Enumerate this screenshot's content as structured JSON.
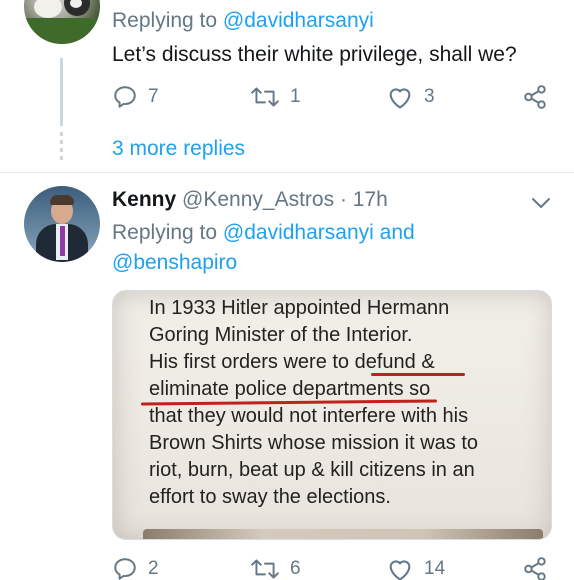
{
  "tweet1": {
    "replying_prefix": "Replying to ",
    "replying_handle": "@davidharsanyi",
    "text": "Let’s discuss their white privilege, shall we?",
    "reply_count": "7",
    "retweet_count": "1",
    "like_count": "3",
    "more_replies": "3 more replies"
  },
  "tweet2": {
    "name": "Kenny",
    "handle": "@Kenny_Astros",
    "separator": "·",
    "time": "17h",
    "replying_prefix": "Replying to ",
    "replying_handle1": "@davidharsanyi",
    "replying_and": " and",
    "replying_handle2": "@benshapiro",
    "image_lines": [
      "In 1933 Hitler appointed Hermann",
      "Goring Minister of the Interior.",
      "His first orders were to defund &",
      "eliminate police departments so",
      "that they would not interfere with his",
      "Brown Shirts whose mission it was to",
      "riot, burn, beat up & kill citizens in an",
      "effort to sway the elections."
    ],
    "reply_count": "2",
    "retweet_count": "6",
    "like_count": "14"
  },
  "colors": {
    "accent": "#1da1f2",
    "muted": "#657786",
    "underline": "#c0211e"
  },
  "icons": [
    "reply-icon",
    "retweet-icon",
    "like-icon",
    "share-icon",
    "chevron-down-icon"
  ]
}
